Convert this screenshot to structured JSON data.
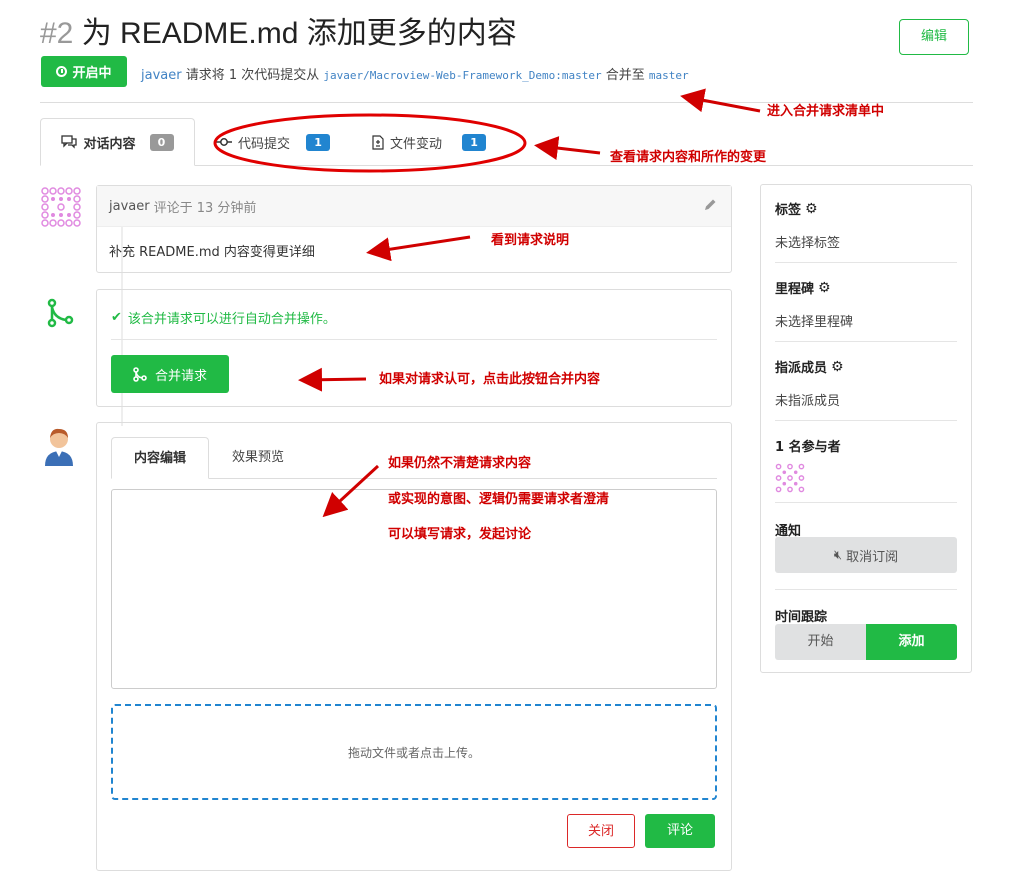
{
  "header": {
    "number": "#2",
    "title": "为 README.md 添加更多的内容",
    "edit_label": "编辑",
    "status": "开启中",
    "author": "javaer",
    "meta_mid": "请求将 1 次代码提交从",
    "source_branch": "javaer/Macroview-Web-Framework_Demo:master",
    "meta_join": "合并至",
    "target_branch": "master"
  },
  "tabs": {
    "conversation": {
      "label": "对话内容",
      "count": "0"
    },
    "commits": {
      "label": "代码提交",
      "count": "1"
    },
    "files": {
      "label": "文件变动",
      "count": "1"
    }
  },
  "comment": {
    "author": "javaer",
    "time": "评论于 13 分钟前",
    "body": "补充 README.md 内容变得更详细"
  },
  "merge": {
    "status": "该合并请求可以进行自动合并操作。",
    "button": "合并请求"
  },
  "editor": {
    "tab_edit": "内容编辑",
    "tab_preview": "效果预览",
    "dropzone": "拖动文件或者点击上传。",
    "close": "关闭",
    "comment": "评论"
  },
  "sidebar": {
    "labels_title": "标签",
    "labels_value": "未选择标签",
    "milestone_title": "里程碑",
    "milestone_value": "未选择里程碑",
    "assignees_title": "指派成员",
    "assignees_value": "未指派成员",
    "participants_title": "1 名参与者",
    "notify_title": "通知",
    "unsubscribe": "取消订阅",
    "tracking_title": "时间跟踪",
    "tracking_start": "开始",
    "tracking_add": "添加"
  },
  "annotations": {
    "merge_list": "进入合并请求清单中",
    "view_changes": "查看请求内容和所作的变更",
    "see_desc": "看到请求说明",
    "approve": "如果对请求认可，点击此按钮合并内容",
    "discuss_1": "如果仍然不清楚请求内容",
    "discuss_2": "或实现的意图、逻辑仍需要请求者澄清",
    "discuss_3": "可以填写请求，发起讨论"
  },
  "colors": {
    "green": "#21ba45",
    "blue": "#2185d0",
    "red_annotation": "#d00000",
    "close_red": "#db2828"
  }
}
